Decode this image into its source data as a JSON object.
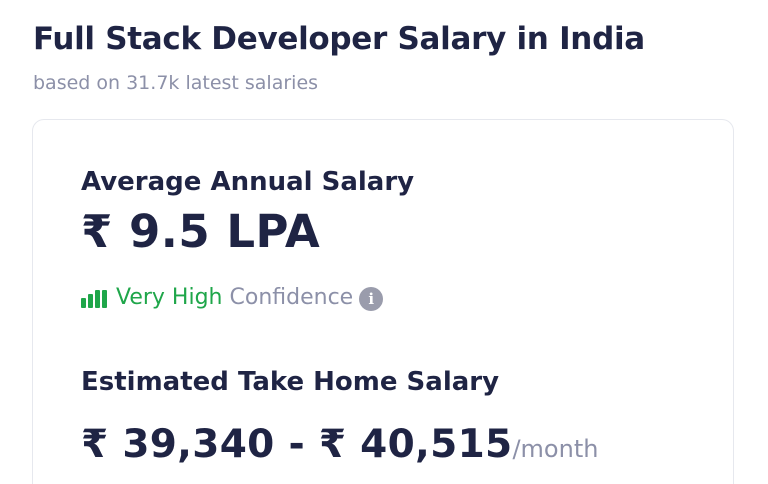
{
  "header": {
    "title": "Full Stack Developer Salary in India",
    "subtitle": "based on 31.7k latest salaries"
  },
  "card": {
    "average": {
      "label": "Average Annual Salary",
      "value": "₹ 9.5 LPA"
    },
    "confidence": {
      "icon": "signal-bars-icon",
      "level": "Very High",
      "word": "Confidence",
      "info_icon": "info-icon",
      "level_color": "#1fa64a"
    },
    "take_home": {
      "label": "Estimated Take Home Salary",
      "range": "₹ 39,340 - ₹ 40,515",
      "unit": "/month"
    }
  }
}
